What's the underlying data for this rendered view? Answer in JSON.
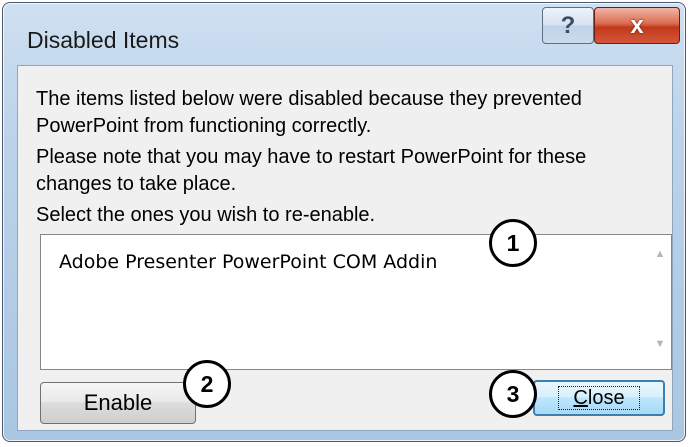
{
  "dialog": {
    "title": "Disabled Items",
    "help_label": "?",
    "close_glyph": "x",
    "message1": "The items listed below were disabled because they prevented PowerPoint from functioning correctly.",
    "message2": "Please note that you may have to restart PowerPoint for these changes to take place.",
    "message3": "Select the ones you wish to re-enable.",
    "items": [
      "Adobe Presenter PowerPoint COM Addin"
    ],
    "enable_label": "Enable",
    "close_label_underlined": "C",
    "close_label_rest": "lose"
  },
  "callouts": [
    "1",
    "2",
    "3"
  ],
  "colors": {
    "title_close_red": "#c2391c",
    "client_bg": "#f0f0f0",
    "default_button_border": "#3c7fb1"
  }
}
